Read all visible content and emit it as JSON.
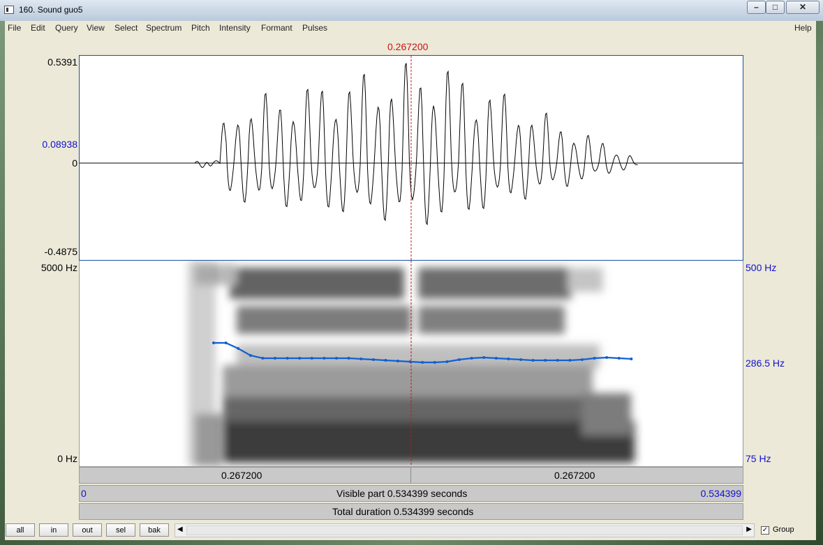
{
  "window": {
    "title": "160. Sound guo5"
  },
  "menu": {
    "items": [
      "File",
      "Edit",
      "Query",
      "View",
      "Select",
      "Spectrum",
      "Pitch",
      "Intensity",
      "Formant",
      "Pulses"
    ],
    "help": "Help"
  },
  "cursor": {
    "time_label": "0.267200"
  },
  "waveform": {
    "y_max": "0.5391",
    "y_cursor": "0.08938",
    "y_zero": "0",
    "y_min": "-0.4875"
  },
  "spectrogram": {
    "freq_top": "5000 Hz",
    "freq_bottom": "0 Hz",
    "pitch_top": "500 Hz",
    "pitch_cursor": "286.5 Hz",
    "pitch_bottom": "75 Hz"
  },
  "time_bar": {
    "left_label": "0.267200",
    "right_label": "0.267200"
  },
  "visible_bar": {
    "start": "0",
    "text": "Visible part 0.534399 seconds",
    "end": "0.534399"
  },
  "total_bar": {
    "text": "Total duration 0.534399 seconds"
  },
  "buttons": {
    "all": "all",
    "in": "in",
    "out": "out",
    "sel": "sel",
    "bak": "bak"
  },
  "scroll": {
    "left_arrow": "◀",
    "right_arrow": "▶"
  },
  "group": {
    "label": "Group",
    "checked": true,
    "check_mark": "✓"
  },
  "colors": {
    "cursor": "#d01010",
    "axis_blue": "#1010d0",
    "pitch": "#1060d0"
  }
}
